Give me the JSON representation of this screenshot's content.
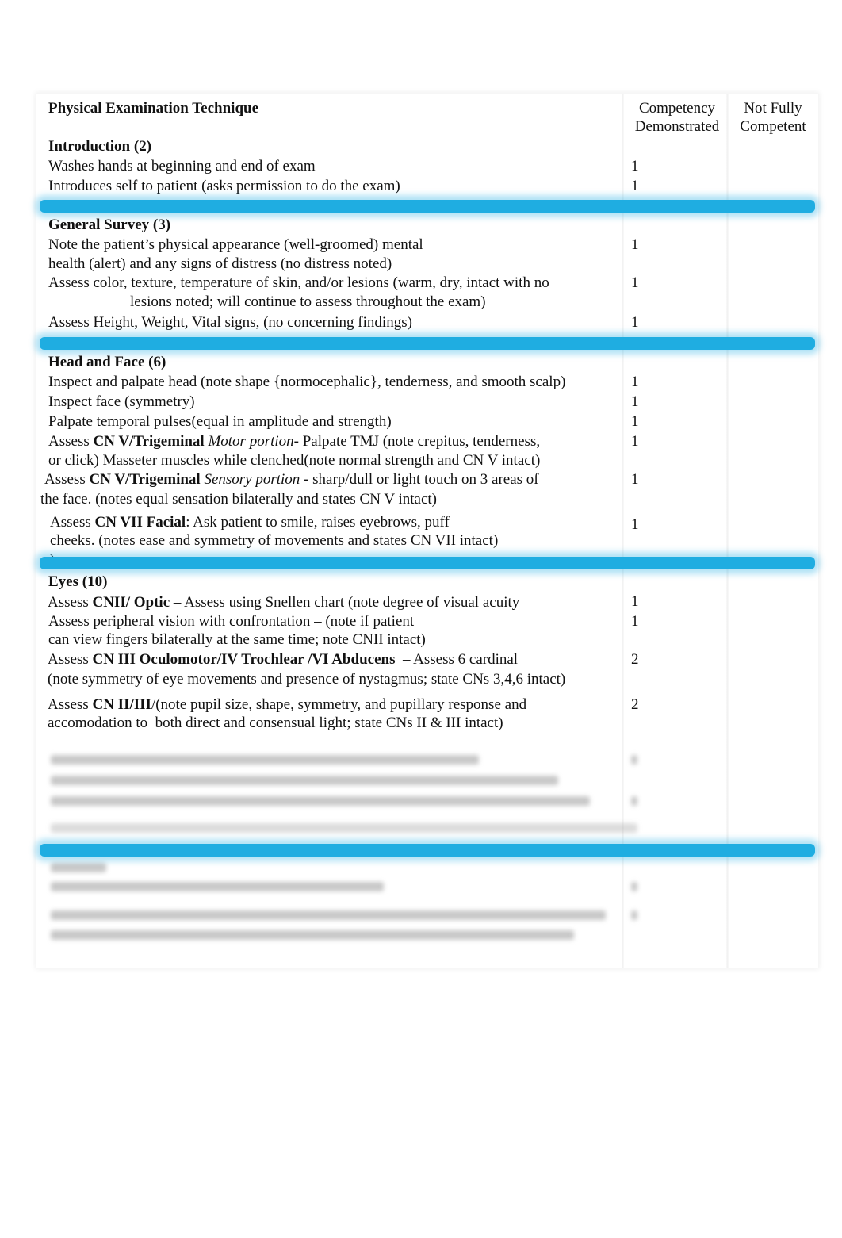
{
  "header": {
    "title": "Physical Examination Technique",
    "col_competency_line1": "Competency",
    "col_competency_line2": "Demonstrated",
    "col_not_fully_line1": "Not Fully",
    "col_not_fully_line2": "Competent"
  },
  "sections": [
    {
      "title": "Introduction (2)",
      "items": [
        {
          "text": "Washes hands at beginning and end of exam",
          "score": "1"
        },
        {
          "text": "Introduces self to patient (asks permission to do the exam)",
          "score": "1"
        }
      ]
    },
    {
      "title": "General Survey (3)",
      "items": [
        {
          "line1": "Note the patient’s physical appearance (well-groomed) mental",
          "line2": "health (alert) and any signs of distress (no distress noted)",
          "score": "1"
        },
        {
          "line1": "Assess color, texture, temperature of skin, and/or lesions (warm, dry, intact with no",
          "line2": "lesions noted; will continue to assess throughout the exam)",
          "score": "1"
        },
        {
          "text": "Assess Height, Weight, Vital signs, (no concerning findings)",
          "score": "1"
        }
      ]
    },
    {
      "title": "Head and Face (6)",
      "items": [
        {
          "text": "Inspect and palpate head (note shape {normocephalic}, tenderness, and smooth scalp)",
          "score": "1"
        },
        {
          "text": "Inspect face (symmetry)",
          "score": "1"
        },
        {
          "text": "Palpate temporal pulses(equal in amplitude and strength)",
          "score": "1"
        },
        {
          "pre": "Assess ",
          "bold": "CN V/Trigeminal",
          "italic": " Motor portion",
          "post": "- Palpate TMJ (note crepitus, tenderness,",
          "line2": "or click) Masseter muscles while clenched(note normal strength and CN V intact)",
          "score": "1"
        },
        {
          "pre": "Assess ",
          "bold": "CN V/Trigeminal",
          "italic": " Sensory portion",
          "post": " - sharp/dull or light touch on 3 areas of",
          "line2": "the face. (notes equal sensation bilaterally and states CN V intact)",
          "score": "1"
        },
        {
          "pre": "Assess ",
          "bold": "CN VII Facial",
          "post": ": Ask patient to smile, raises eyebrows, puff",
          "line2": "cheeks. (notes ease and symmetry of movements and states CN VII intact)",
          "line3": ")",
          "score": "1"
        }
      ]
    },
    {
      "title": "Eyes (10)",
      "items": [
        {
          "pre": "Assess ",
          "bold": "CNII/ Optic",
          "post": " – Assess using Snellen chart (note degree of visual acuity",
          "score": "1"
        },
        {
          "line1": "Assess peripheral vision with confrontation – (note if patient",
          "line2": "can view fingers bilaterally at the same time; note CNII intact)",
          "score": "1"
        },
        {
          "pre": "Assess ",
          "bold": "CN III Oculomotor/IV Trochlear /VI Abducens",
          "post": "  – Assess 6 cardinal",
          "line2": "(note symmetry of eye movements and presence of nystagmus; state CNs 3,4,6 intact)",
          "score": "2"
        },
        {
          "pre": "Assess ",
          "bold": "CN II/III",
          "post": "/(note pupil size, shape, symmetry, and pupillary response and",
          "line2": "accomodation to  both direct and consensual light; state CNs II & III intact)",
          "score": "2"
        }
      ]
    }
  ],
  "colors": {
    "section_band": "#1fade1"
  }
}
